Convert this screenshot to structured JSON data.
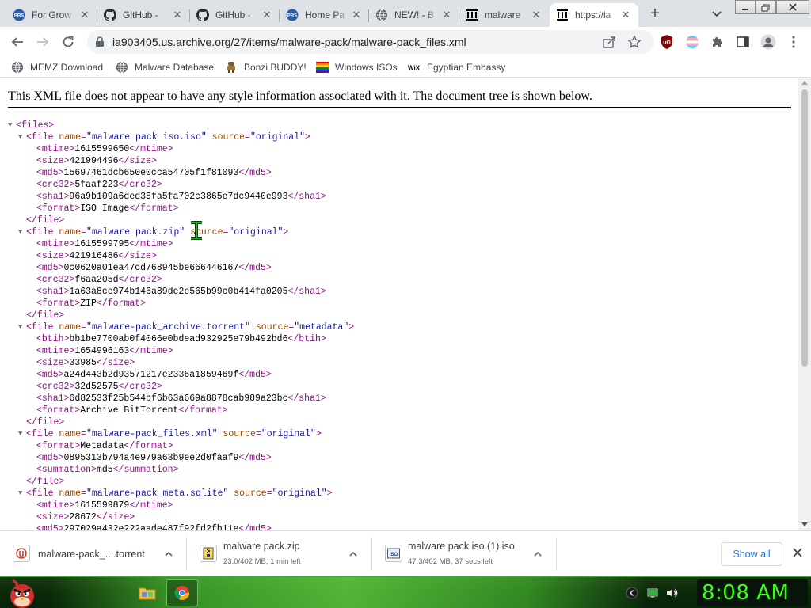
{
  "browser": {
    "tabs": [
      {
        "title": "For Grow",
        "icon": "prs-logo-icon"
      },
      {
        "title": "GitHub -",
        "icon": "github-icon"
      },
      {
        "title": "GitHub -",
        "icon": "github-icon"
      },
      {
        "title": "Home Pa",
        "icon": "prs-logo-icon"
      },
      {
        "title": "NEW! - B",
        "icon": "globe-icon"
      },
      {
        "title": "malware",
        "icon": "archive-org-icon"
      },
      {
        "title": "https://ia",
        "icon": "archive-org-icon",
        "active": true
      }
    ],
    "new_tab_label": "+",
    "url": "ia903405.us.archive.org/27/items/malware-pack/malware-pack_files.xml",
    "bookmarks": [
      {
        "label": "MEMZ Download",
        "icon": "globe-icon"
      },
      {
        "label": "Malware Database",
        "icon": "globe-icon"
      },
      {
        "label": "Bonzi BUDDY!",
        "icon": "bonzi-icon"
      },
      {
        "label": "Windows ISOs",
        "icon": "rainbow-flag-icon"
      },
      {
        "label": "Egyptian Embassy",
        "icon": "wix-icon"
      }
    ]
  },
  "page": {
    "notice": "This XML file does not appear to have any style information associated with it. The document tree is shown below.",
    "xml_lines": [
      {
        "indent": 0,
        "toggle": true,
        "parts": [
          [
            "t",
            "<files>"
          ]
        ]
      },
      {
        "indent": 1,
        "toggle": true,
        "parts": [
          [
            "t",
            "<file "
          ],
          [
            "n",
            "name"
          ],
          [
            "t",
            "="
          ],
          [
            "v",
            "\"malware pack iso.iso\""
          ],
          [
            "t",
            " "
          ],
          [
            "n",
            "source"
          ],
          [
            "t",
            "="
          ],
          [
            "v",
            "\"original\""
          ],
          [
            "t",
            ">"
          ]
        ]
      },
      {
        "indent": 2,
        "parts": [
          [
            "t",
            "<mtime>"
          ],
          [
            "x",
            "1615599650"
          ],
          [
            "t",
            "</mtime>"
          ]
        ]
      },
      {
        "indent": 2,
        "parts": [
          [
            "t",
            "<size>"
          ],
          [
            "x",
            "421994496"
          ],
          [
            "t",
            "</size>"
          ]
        ]
      },
      {
        "indent": 2,
        "parts": [
          [
            "t",
            "<md5>"
          ],
          [
            "x",
            "15697461dcb650e0cca54705f1f81093"
          ],
          [
            "t",
            "</md5>"
          ]
        ]
      },
      {
        "indent": 2,
        "parts": [
          [
            "t",
            "<crc32>"
          ],
          [
            "x",
            "5faaf223"
          ],
          [
            "t",
            "</crc32>"
          ]
        ]
      },
      {
        "indent": 2,
        "parts": [
          [
            "t",
            "<sha1>"
          ],
          [
            "x",
            "96a9b109a6ded35fa5fa702c3865e7dc9440e993"
          ],
          [
            "t",
            "</sha1>"
          ]
        ]
      },
      {
        "indent": 2,
        "parts": [
          [
            "t",
            "<format>"
          ],
          [
            "x",
            "ISO Image"
          ],
          [
            "t",
            "</format>"
          ]
        ]
      },
      {
        "indent": 1,
        "parts": [
          [
            "t",
            "</file>"
          ]
        ]
      },
      {
        "indent": 1,
        "toggle": true,
        "parts": [
          [
            "t",
            "<file "
          ],
          [
            "n",
            "name"
          ],
          [
            "t",
            "="
          ],
          [
            "v",
            "\"malware pack.zip\""
          ],
          [
            "t",
            " "
          ],
          [
            "n",
            "source"
          ],
          [
            "t",
            "="
          ],
          [
            "v",
            "\"original\""
          ],
          [
            "t",
            ">"
          ]
        ]
      },
      {
        "indent": 2,
        "parts": [
          [
            "t",
            "<mtime>"
          ],
          [
            "x",
            "1615599795"
          ],
          [
            "t",
            "</mtime>"
          ]
        ]
      },
      {
        "indent": 2,
        "parts": [
          [
            "t",
            "<size>"
          ],
          [
            "x",
            "421916486"
          ],
          [
            "t",
            "</size>"
          ]
        ]
      },
      {
        "indent": 2,
        "parts": [
          [
            "t",
            "<md5>"
          ],
          [
            "x",
            "0c0620a01ea47cd768945be666446167"
          ],
          [
            "t",
            "</md5>"
          ]
        ]
      },
      {
        "indent": 2,
        "parts": [
          [
            "t",
            "<crc32>"
          ],
          [
            "x",
            "f6aa205d"
          ],
          [
            "t",
            "</crc32>"
          ]
        ]
      },
      {
        "indent": 2,
        "parts": [
          [
            "t",
            "<sha1>"
          ],
          [
            "x",
            "1a63a8ce974b146a89de2e565b99c0b414fa0205"
          ],
          [
            "t",
            "</sha1>"
          ]
        ]
      },
      {
        "indent": 2,
        "parts": [
          [
            "t",
            "<format>"
          ],
          [
            "x",
            "ZIP"
          ],
          [
            "t",
            "</format>"
          ]
        ]
      },
      {
        "indent": 1,
        "parts": [
          [
            "t",
            "</file>"
          ]
        ]
      },
      {
        "indent": 1,
        "toggle": true,
        "parts": [
          [
            "t",
            "<file "
          ],
          [
            "n",
            "name"
          ],
          [
            "t",
            "="
          ],
          [
            "v",
            "\"malware-pack_archive.torrent\""
          ],
          [
            "t",
            " "
          ],
          [
            "n",
            "source"
          ],
          [
            "t",
            "="
          ],
          [
            "v",
            "\"metadata\""
          ],
          [
            "t",
            ">"
          ]
        ]
      },
      {
        "indent": 2,
        "parts": [
          [
            "t",
            "<btih>"
          ],
          [
            "x",
            "bb1be7700ab0f4066e0bdead932925e79b492bd6"
          ],
          [
            "t",
            "</btih>"
          ]
        ]
      },
      {
        "indent": 2,
        "parts": [
          [
            "t",
            "<mtime>"
          ],
          [
            "x",
            "1654996163"
          ],
          [
            "t",
            "</mtime>"
          ]
        ]
      },
      {
        "indent": 2,
        "parts": [
          [
            "t",
            "<size>"
          ],
          [
            "x",
            "33985"
          ],
          [
            "t",
            "</size>"
          ]
        ]
      },
      {
        "indent": 2,
        "parts": [
          [
            "t",
            "<md5>"
          ],
          [
            "x",
            "a24d443b2d93571217e2336a1859469f"
          ],
          [
            "t",
            "</md5>"
          ]
        ]
      },
      {
        "indent": 2,
        "parts": [
          [
            "t",
            "<crc32>"
          ],
          [
            "x",
            "32d52575"
          ],
          [
            "t",
            "</crc32>"
          ]
        ]
      },
      {
        "indent": 2,
        "parts": [
          [
            "t",
            "<sha1>"
          ],
          [
            "x",
            "6d82533f25b544bf6b63a669a8878cab989a23bc"
          ],
          [
            "t",
            "</sha1>"
          ]
        ]
      },
      {
        "indent": 2,
        "parts": [
          [
            "t",
            "<format>"
          ],
          [
            "x",
            "Archive BitTorrent"
          ],
          [
            "t",
            "</format>"
          ]
        ]
      },
      {
        "indent": 1,
        "parts": [
          [
            "t",
            "</file>"
          ]
        ]
      },
      {
        "indent": 1,
        "toggle": true,
        "parts": [
          [
            "t",
            "<file "
          ],
          [
            "n",
            "name"
          ],
          [
            "t",
            "="
          ],
          [
            "v",
            "\"malware-pack_files.xml\""
          ],
          [
            "t",
            " "
          ],
          [
            "n",
            "source"
          ],
          [
            "t",
            "="
          ],
          [
            "v",
            "\"original\""
          ],
          [
            "t",
            ">"
          ]
        ]
      },
      {
        "indent": 2,
        "parts": [
          [
            "t",
            "<format>"
          ],
          [
            "x",
            "Metadata"
          ],
          [
            "t",
            "</format>"
          ]
        ]
      },
      {
        "indent": 2,
        "parts": [
          [
            "t",
            "<md5>"
          ],
          [
            "x",
            "0895313b794a4e979a63b9ee2d0faaf9"
          ],
          [
            "t",
            "</md5>"
          ]
        ]
      },
      {
        "indent": 2,
        "parts": [
          [
            "t",
            "<summation>"
          ],
          [
            "x",
            "md5"
          ],
          [
            "t",
            "</summation>"
          ]
        ]
      },
      {
        "indent": 1,
        "parts": [
          [
            "t",
            "</file>"
          ]
        ]
      },
      {
        "indent": 1,
        "toggle": true,
        "parts": [
          [
            "t",
            "<file "
          ],
          [
            "n",
            "name"
          ],
          [
            "t",
            "="
          ],
          [
            "v",
            "\"malware-pack_meta.sqlite\""
          ],
          [
            "t",
            " "
          ],
          [
            "n",
            "source"
          ],
          [
            "t",
            "="
          ],
          [
            "v",
            "\"original\""
          ],
          [
            "t",
            ">"
          ]
        ]
      },
      {
        "indent": 2,
        "parts": [
          [
            "t",
            "<mtime>"
          ],
          [
            "x",
            "1615599879"
          ],
          [
            "t",
            "</mtime>"
          ]
        ]
      },
      {
        "indent": 2,
        "parts": [
          [
            "t",
            "<size>"
          ],
          [
            "x",
            "28672"
          ],
          [
            "t",
            "</size>"
          ]
        ]
      },
      {
        "indent": 2,
        "parts": [
          [
            "t",
            "<md5>"
          ],
          [
            "x",
            "297029a432e222aade487f92fd2fb11e"
          ],
          [
            "t",
            "</md5>"
          ]
        ]
      }
    ]
  },
  "downloads": {
    "items": [
      {
        "name": "malware-pack_....torrent",
        "status": "",
        "icon": "torrent-file-icon"
      },
      {
        "name": "malware pack.zip",
        "status": "23.0/402 MB, 1 min left",
        "icon": "zip-file-icon"
      },
      {
        "name": "malware pack iso (1).iso",
        "status": "47.3/402 MB, 37 secs left",
        "icon": "iso-file-icon"
      }
    ],
    "show_all_label": "Show all"
  },
  "taskbar": {
    "clock": "8:08 AM"
  },
  "colors": {
    "xml_tag": "#881280",
    "xml_attr_name": "#994500",
    "xml_attr_value": "#1a1aa6",
    "link_blue": "#1a73e8",
    "taskbar_green": "#39ff14"
  }
}
